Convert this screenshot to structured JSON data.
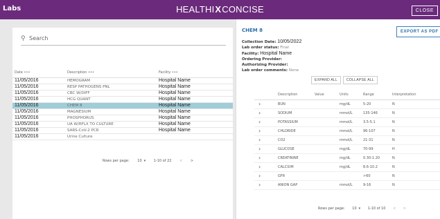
{
  "app_title": "Labs",
  "brand": {
    "left": "HEALTHI",
    "mark": "X",
    "right": "CONCISE"
  },
  "close_label": "CLOSE",
  "search": {
    "placeholder": "Search"
  },
  "labs_table": {
    "headers": {
      "date": "Date •••",
      "description": "Description •••",
      "facility": "Facility •••"
    },
    "rows": [
      {
        "date": "11/05/2016",
        "description": "HEMOGRAM",
        "facility": "Hospital Name"
      },
      {
        "date": "11/05/2016",
        "description": "RESP PATHOGENS PNL",
        "facility": "Hospital Name"
      },
      {
        "date": "11/05/2016",
        "description": "CBC W/DIFF",
        "facility": "Hospital Name"
      },
      {
        "date": "11/05/2016",
        "description": "HCG QUANT",
        "facility": "Hospital Name"
      },
      {
        "date": "11/05/2016",
        "description": "CHEM 8",
        "facility": "Hospital Name"
      },
      {
        "date": "11/05/2016",
        "description": "MAGNESIUM",
        "facility": "Hospital Name"
      },
      {
        "date": "11/05/2016",
        "description": "PHOSPHORUS",
        "facility": "Hospital Name"
      },
      {
        "date": "11/05/2016",
        "description": "UA W/RFLX TO CULTURE",
        "facility": "Hospital Name"
      },
      {
        "date": "11/05/2016",
        "description": "SARS-CoV-2 PCR",
        "facility": "Hospital Name"
      },
      {
        "date": "11/05/2016",
        "description": "Urine Culture",
        "facility": ""
      }
    ],
    "selected_index": 4
  },
  "left_pager": {
    "rows_label": "Rows per page:",
    "rows_value": "10",
    "range": "1-10 of 22",
    "prev": "<",
    "next": ">"
  },
  "detail": {
    "title": "CHEM 8",
    "export_label": "EXPORT AS PDF",
    "collection_label": "Collection Date:",
    "collection_value": "10/05/2022",
    "status_label": "Lab order status:",
    "status_value": "Final",
    "facility_label": "Facility:",
    "facility_value": "Hospital Name",
    "ordering_label": "Ordering Provider:",
    "authorizing_label": "Authorizing Provider:",
    "comments_label": "Lab order comments:",
    "comments_value": "None",
    "expand_label": "EXPAND ALL",
    "collapse_label": "COLLAPSE ALL"
  },
  "results_table": {
    "headers": {
      "description": "Description",
      "value": "Value",
      "units": "Units",
      "range": "Range",
      "interpretation": "Interpretation"
    },
    "rows": [
      {
        "description": "BUN",
        "value": "",
        "units": "mg/dL",
        "range": "5-20",
        "interpretation": "N"
      },
      {
        "description": "SODIUM",
        "value": "",
        "units": "mmol/L",
        "range": "135-146",
        "interpretation": "N"
      },
      {
        "description": "POTASSIUM",
        "value": "",
        "units": "mmol/L",
        "range": "3.5-5.1",
        "interpretation": "N"
      },
      {
        "description": "CHLORIDE",
        "value": "",
        "units": "mmol/L",
        "range": "96-107",
        "interpretation": "N"
      },
      {
        "description": "CO2",
        "value": "",
        "units": "mmol/L",
        "range": "21-31",
        "interpretation": "N"
      },
      {
        "description": "GLUCOSE",
        "value": "",
        "units": "mg/dL",
        "range": "70-99",
        "interpretation": "H"
      },
      {
        "description": "CREATININE",
        "value": "",
        "units": "mg/dL",
        "range": "0.30-1.20",
        "interpretation": "N"
      },
      {
        "description": "CALCIUM",
        "value": "",
        "units": "mg/dL",
        "range": "8.6-10.2",
        "interpretation": "N"
      },
      {
        "description": "GFR",
        "value": "",
        "units": "",
        "range": ">60",
        "interpretation": "N"
      },
      {
        "description": "ANION GAP",
        "value": "",
        "units": "mmol/L",
        "range": "9-16",
        "interpretation": "N"
      }
    ]
  },
  "right_pager": {
    "rows_label": "Rows per page:",
    "rows_value": "10",
    "range": "1-10 of 10",
    "prev": "<",
    "next": ">"
  },
  "colors": {
    "topbar": "#6b2a7c",
    "selected_row": "#9fcdd8",
    "accent_blue": "#2a6fa8"
  }
}
